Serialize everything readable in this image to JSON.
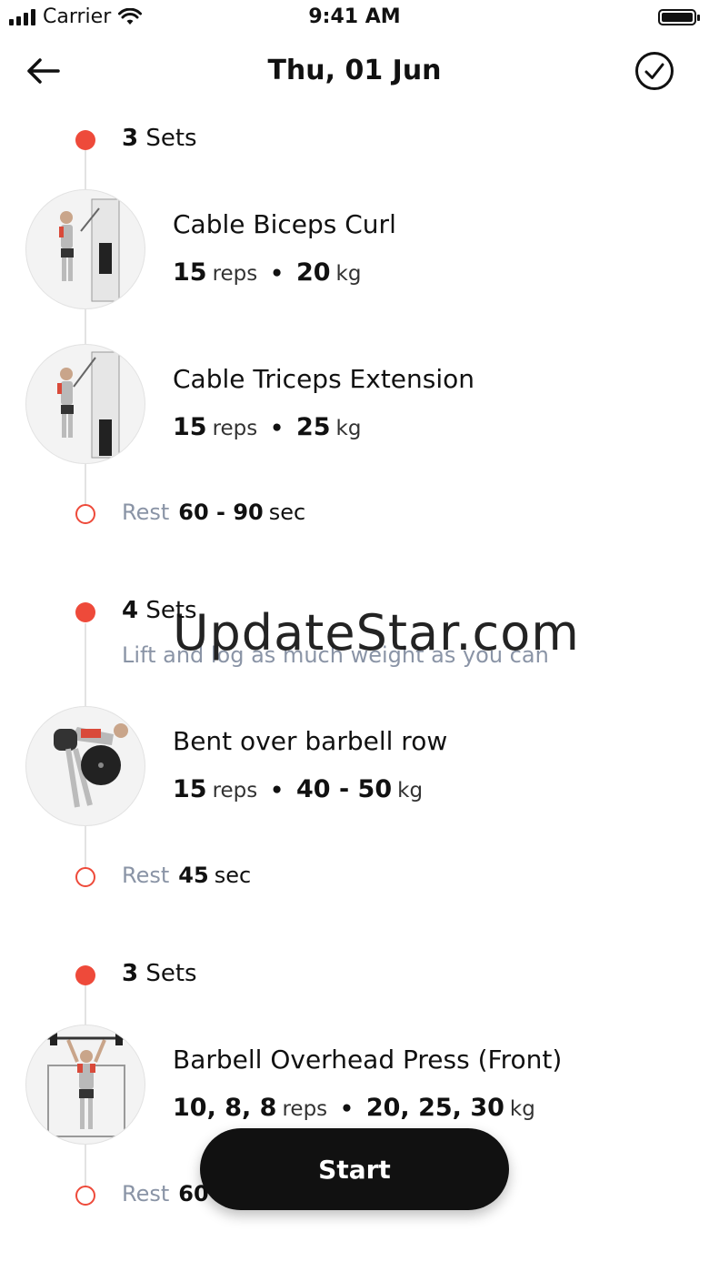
{
  "status": {
    "carrier": "Carrier",
    "time": "9:41 AM"
  },
  "header": {
    "title": "Thu, 01 Jun",
    "back_icon": "arrow-left-icon",
    "done_icon": "check-circle-icon"
  },
  "groups": [
    {
      "sets_count": "3",
      "sets_label": "Sets",
      "exercises": [
        {
          "name": "Cable Biceps Curl",
          "reps": "15",
          "reps_unit": "reps",
          "weight": "20",
          "weight_unit": "kg"
        },
        {
          "name": "Cable Triceps Extension",
          "reps": "15",
          "reps_unit": "reps",
          "weight": "25",
          "weight_unit": "kg"
        }
      ],
      "rest": {
        "label": "Rest",
        "value": "60 - 90",
        "unit": "sec"
      }
    },
    {
      "sets_count": "4",
      "sets_label": "Sets",
      "note": "Lift and log as much weight as you can",
      "exercises": [
        {
          "name": "Bent over barbell row",
          "reps": "15",
          "reps_unit": "reps",
          "weight": "40 - 50",
          "weight_unit": "kg"
        }
      ],
      "rest": {
        "label": "Rest",
        "value": "45",
        "unit": "sec"
      }
    },
    {
      "sets_count": "3",
      "sets_label": "Sets",
      "exercises": [
        {
          "name": "Barbell Overhead Press (Front)",
          "reps": "10, 8, 8",
          "reps_unit": "reps",
          "weight": "20, 25, 30",
          "weight_unit": "kg"
        }
      ],
      "rest": {
        "label": "Rest",
        "value": "60"
      }
    }
  ],
  "watermark": "UpdateStar.com",
  "start_button": "Start"
}
